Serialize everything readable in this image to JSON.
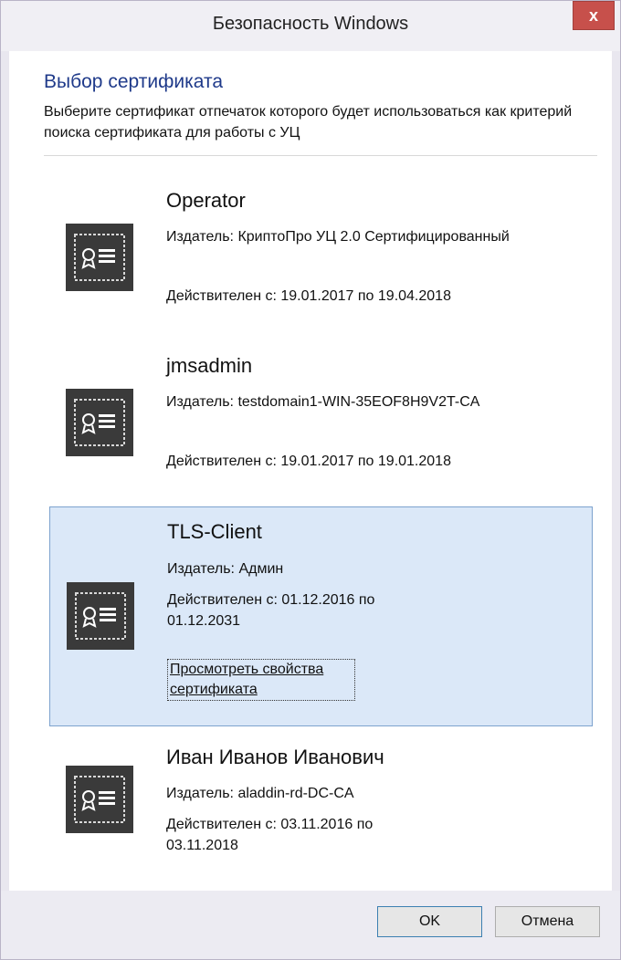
{
  "window": {
    "title": "Безопасность Windows",
    "close_glyph": "x"
  },
  "header": {
    "title": "Выбор сертификата",
    "description": "Выберите сертификат отпечаток которого будет использоваться как критерий поиска сертификата для работы с УЦ"
  },
  "certificates": [
    {
      "name": "Operator",
      "issuer": "Издатель: КриптоПро УЦ 2.0 Сертифицированный",
      "validity": "Действителен с: 19.01.2017 по 19.04.2018",
      "icon": "certificate-icon"
    },
    {
      "name": "jmsadmin",
      "issuer": "Издатель: testdomain1-WIN-35EOF8H9V2T-CA",
      "validity": "Действителен с: 19.01.2017 по 19.01.2018",
      "icon": "certificate-icon"
    },
    {
      "name": "TLS-Client",
      "issuer": "Издатель: Админ",
      "validity": "Действителен с: 01.12.2016 по 01.12.2031",
      "link": "Просмотреть свойства сертификата",
      "selected": true,
      "icon": "certificate-icon"
    },
    {
      "name": "Иван Иванов Иванович",
      "issuer": "Издатель: aladdin-rd-DC-CA",
      "validity": "Действителен с: 03.11.2016 по 03.11.2018",
      "icon": "certificate-icon"
    }
  ],
  "footer": {
    "ok_label": "OK",
    "cancel_label": "Отмена"
  },
  "colors": {
    "accent_title": "#1f3a8a",
    "selection_bg": "#dbe8f8",
    "selection_border": "#7da2ce",
    "close_button": "#c7504b"
  }
}
